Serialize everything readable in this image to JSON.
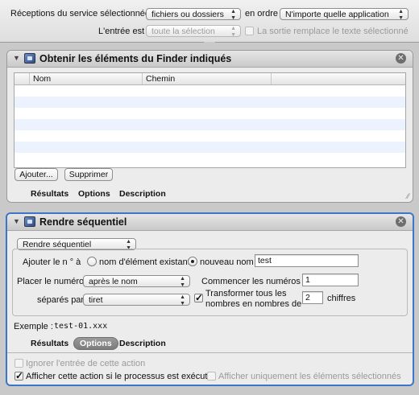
{
  "service": {
    "receives_label": "Réceptions du service sélectionnées",
    "receives_value": "fichiers ou dossiers",
    "in_label": "en ordre",
    "app_value": "N'importe quelle application",
    "input_label": "L'entrée est",
    "input_value": "toute la sélection",
    "replace_label": "La sortie remplace le texte sélectionné"
  },
  "action1": {
    "title": "Obtenir les éléments du Finder indiqués",
    "columns": [
      "Nom",
      "Chemin"
    ],
    "add_label": "Ajouter...",
    "remove_label": "Supprimer",
    "tabs": [
      "Résultats",
      "Options",
      "Description"
    ]
  },
  "action2": {
    "title": "Rendre séquentiel",
    "mode_value": "Rendre séquentiel",
    "add_label": "Ajouter le n ° à",
    "radio1_label": "nom d'élément existant",
    "radio2_label": "nouveau nom",
    "new_name_value": "test",
    "place_label": "Placer le numéro",
    "place_value": "après le nom",
    "start_label": "Commencer les numéros à",
    "start_value": "1",
    "sep_label": "séparés par",
    "sep_value": "tiret",
    "transform_label_1": "Transformer tous les",
    "transform_label_2": "nombres en nombres de",
    "digits_value": "2",
    "digits_label": "chiffres",
    "example_label": "Exemple :",
    "example_value": "test-01.xxx",
    "tabs": [
      "Résultats",
      "Options",
      "Description"
    ],
    "ignore_label": "Ignorer l'entrée de cette action",
    "show_label": "Afficher cette action si le processus est exécuté",
    "show_selected_label": "Afficher uniquement les éléments sélectionnés"
  },
  "colors": {
    "selection": "#3d76c8",
    "stripe": "#edf3fe"
  }
}
